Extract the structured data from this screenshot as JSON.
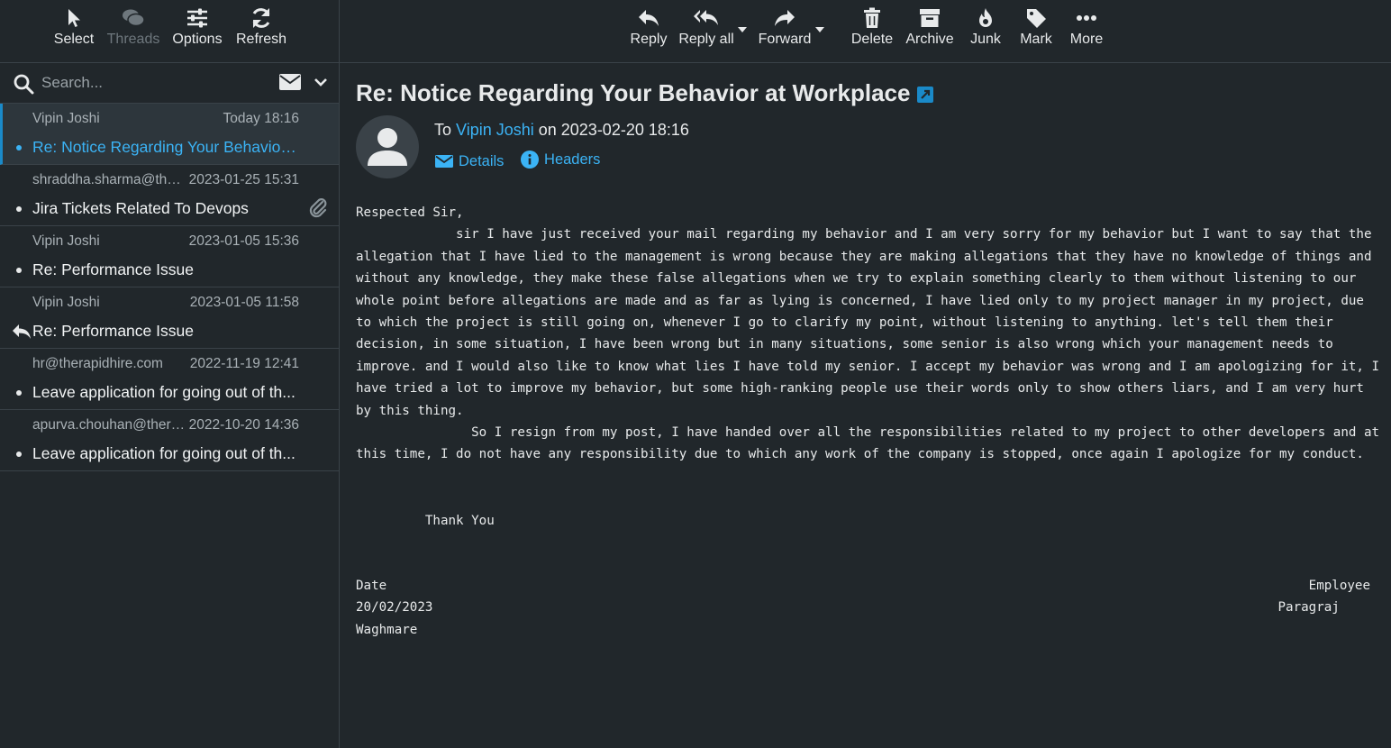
{
  "left_toolbar": {
    "select": "Select",
    "threads": "Threads",
    "options": "Options",
    "refresh": "Refresh"
  },
  "search": {
    "placeholder": "Search..."
  },
  "messages": [
    {
      "from": "Vipin Joshi",
      "date": "Today 18:16",
      "subject": "Re: Notice Regarding Your Behavior at Workplace",
      "selected": true
    },
    {
      "from": "shraddha.sharma@therapidhire.com",
      "date": "2023-01-25 15:31",
      "subject": "Jira Tickets Related To Devops",
      "attachment": true
    },
    {
      "from": "Vipin Joshi",
      "date": "2023-01-05 15:36",
      "subject": "Re: Performance Issue"
    },
    {
      "from": "Vipin Joshi",
      "date": "2023-01-05 11:58",
      "subject": "Re: Performance Issue",
      "replied": true
    },
    {
      "from": "hr@therapidhire.com",
      "date": "2022-11-19 12:41",
      "subject": "Leave application for going out of th..."
    },
    {
      "from": "apurva.chouhan@therapidhire.com",
      "date": "2022-10-20 14:36",
      "subject": "Leave application for going out of th..."
    }
  ],
  "right_toolbar": {
    "reply": "Reply",
    "reply_all": "Reply all",
    "forward": "Forward",
    "delete": "Delete",
    "archive": "Archive",
    "junk": "Junk",
    "mark": "Mark",
    "more": "More"
  },
  "email": {
    "subject": "Re: Notice Regarding Your Behavior at Workplace",
    "to_prefix": "To ",
    "to_name": "Vipin Joshi",
    "date_text": " on 2023-02-20 18:16",
    "details": "Details",
    "headers": "Headers",
    "body": "Respected Sir,\n             sir I have just received your mail regarding my behavior and I am very sorry for my behavior but I want to say that the allegation that I have lied to the management is wrong because they are making allegations that they have no knowledge of things and without any knowledge, they make these false allegations when we try to explain something clearly to them without listening to our whole point before allegations are made and as far as lying is concerned, I have lied only to my project manager in my project, due to which the project is still going on, whenever I go to clarify my point, without listening to anything. let's tell them their decision, in some situation, I have been wrong but in many situations, some senior is also wrong which your management needs to improve. and I would also like to know what lies I have told my senior. I accept my behavior was wrong and I am apologizing for it, I have tried a lot to improve my behavior, but some high-ranking people use their words only to show others liars, and I am very hurt by this thing.\n               So I resign from my post, I have handed over all the responsibilities related to my project to other developers and at this time, I do not have any responsibility due to which any work of the company is stopped, once again I apologize for my conduct.\n\n\n         Thank You",
    "sig_left": "Date\n20/02/2023\nWaghmare",
    "sig_right": "Employee\nParagraj    "
  },
  "colors": {
    "background": "#21272b",
    "accent": "#3bb3f5",
    "selected_row": "#2d363c",
    "border": "#3a4248"
  }
}
